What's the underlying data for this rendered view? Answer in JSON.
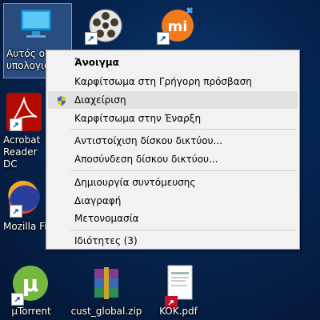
{
  "desktop": {
    "icons": [
      {
        "label": "Αυτός ο υπολογιστής",
        "icon": "computer-icon",
        "shortcut": false
      },
      {
        "label": "",
        "icon": "film-reel-icon",
        "shortcut": true
      },
      {
        "label": "",
        "icon": "mi-logo-icon",
        "shortcut": true
      },
      {
        "label": "Acrobat Reader DC",
        "icon": "acrobat-icon",
        "shortcut": true
      },
      {
        "label": "Mozilla Firefox",
        "icon": "firefox-icon",
        "shortcut": true
      },
      {
        "label": "µTorrent",
        "icon": "utorrent-icon",
        "shortcut": true
      },
      {
        "label": "cust_global.zip",
        "icon": "winrar-icon",
        "shortcut": false
      },
      {
        "label": "KOK.pdf",
        "icon": "pdf-file-icon",
        "shortcut": true
      }
    ]
  },
  "context_menu": {
    "items": [
      {
        "label": "Άνοιγμα",
        "bold": true
      },
      {
        "label": "Καρφίτσωμα στη Γρήγορη πρόσβαση"
      },
      {
        "label": "Διαχείριση",
        "icon": "uac-shield-icon",
        "highlighted": true
      },
      {
        "label": "Καρφίτσωμα στην Έναρξη"
      },
      {
        "label": "Αντιστοίχιση δίσκου δικτύου..."
      },
      {
        "label": "Αποσύνδεση δίσκου δικτύου..."
      },
      {
        "label": "Δημιουργία συντόμευσης"
      },
      {
        "label": "Διαγραφή"
      },
      {
        "label": "Μετονομασία"
      },
      {
        "label": "Ιδιότητες (3)"
      }
    ]
  },
  "colors": {
    "desktop_bg": "#06244f",
    "menu_bg": "#f2f2f2",
    "menu_highlight": "#e1e1e1",
    "selection": "#6ea0e6"
  }
}
